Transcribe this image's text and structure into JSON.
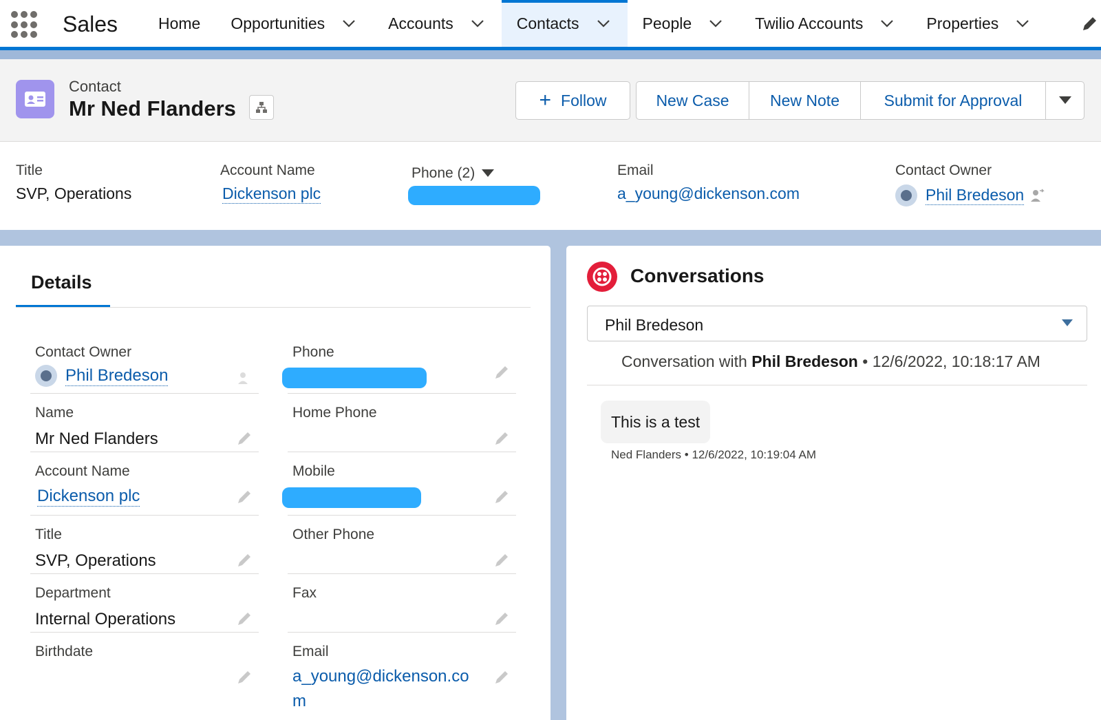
{
  "app": {
    "name": "Sales"
  },
  "nav": {
    "items": [
      {
        "label": "Home",
        "has_menu": false,
        "active": false
      },
      {
        "label": "Opportunities",
        "has_menu": true,
        "active": false
      },
      {
        "label": "Accounts",
        "has_menu": true,
        "active": false
      },
      {
        "label": "Contacts",
        "has_menu": true,
        "active": true
      },
      {
        "label": "People",
        "has_menu": true,
        "active": false
      },
      {
        "label": "Twilio Accounts",
        "has_menu": true,
        "active": false
      },
      {
        "label": "Properties",
        "has_menu": true,
        "active": false
      }
    ]
  },
  "record": {
    "type": "Contact",
    "name": "Mr Ned Flanders",
    "icon": "contact-card-icon",
    "icon_color": "#a094ed"
  },
  "actions": {
    "follow": "Follow",
    "new_case": "New Case",
    "new_note": "New Note",
    "submit": "Submit for Approval"
  },
  "highlights": {
    "title_label": "Title",
    "title_value": "SVP, Operations",
    "account_label": "Account Name",
    "account_value": "Dickenson plc",
    "phone_label": "Phone (2)",
    "email_label": "Email",
    "email_value": "a_young@dickenson.com",
    "owner_label": "Contact Owner",
    "owner_value": "Phil Bredeson"
  },
  "details": {
    "tab": "Details",
    "left": [
      {
        "label": "Contact Owner",
        "value": "Phil Bredeson",
        "link": true
      },
      {
        "label": "Name",
        "value": "Mr Ned Flanders",
        "link": false
      },
      {
        "label": "Account Name",
        "value": "Dickenson plc",
        "link": true
      },
      {
        "label": "Title",
        "value": "SVP, Operations",
        "link": false
      },
      {
        "label": "Department",
        "value": "Internal Operations",
        "link": false
      },
      {
        "label": "Birthdate",
        "value": "",
        "link": false
      }
    ],
    "right": [
      {
        "label": "Phone",
        "value": "",
        "redacted": true
      },
      {
        "label": "Home Phone",
        "value": "",
        "redacted": false
      },
      {
        "label": "Mobile",
        "value": "",
        "redacted": true
      },
      {
        "label": "Other Phone",
        "value": "",
        "redacted": false
      },
      {
        "label": "Fax",
        "value": "",
        "redacted": false
      },
      {
        "label": "Email",
        "value": "a_young@dickenson.co",
        "value2": "m",
        "link": true
      }
    ]
  },
  "conversations": {
    "title": "Conversations",
    "selected_user": "Phil Bredeson",
    "meta_prefix": "Conversation with",
    "meta_name": "Phil Bredeson",
    "meta_time": "• 12/6/2022, 10:18:17 AM",
    "message": "This is a test",
    "message_meta": "Ned Flanders • 12/6/2022, 10:19:04 AM"
  },
  "colors": {
    "brand": "#0176d3",
    "link": "#0b5cab",
    "redaction": "#2eacff",
    "twilio": "#e31e3a"
  }
}
